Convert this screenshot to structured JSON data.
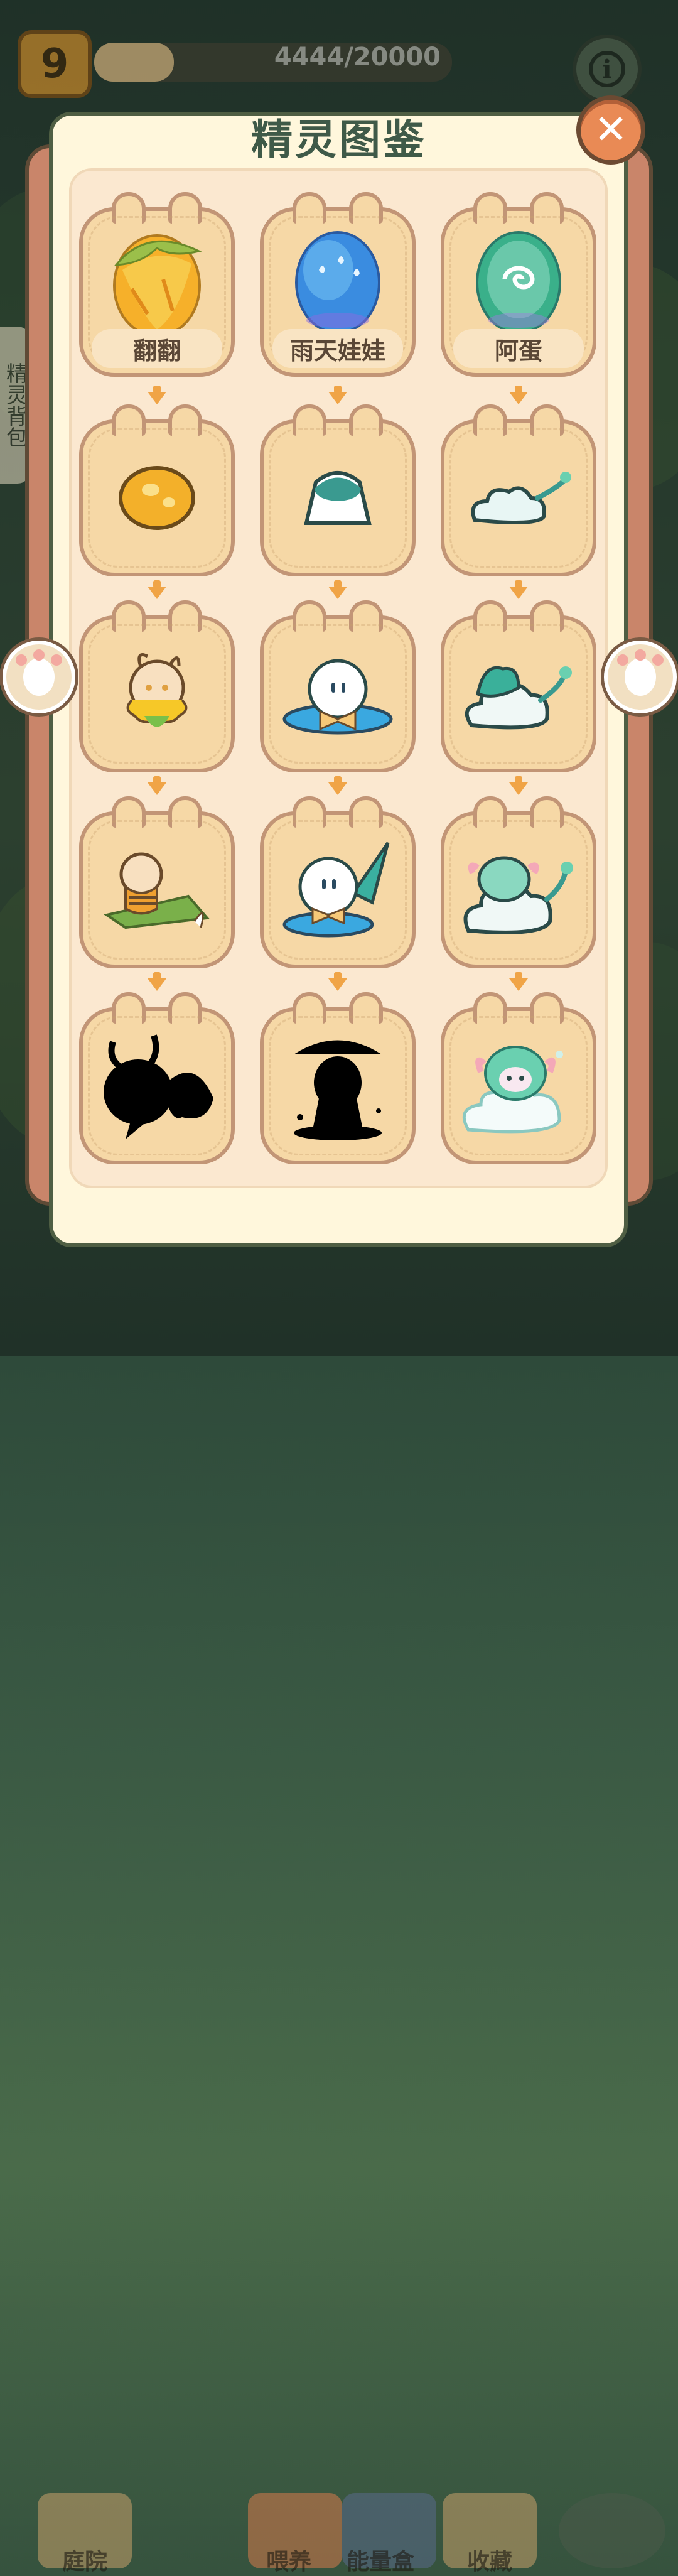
{
  "hud": {
    "level": "9",
    "xp_text": "4444/20000",
    "xp_progress": 0.2222
  },
  "side_tab": {
    "label": "精灵背包"
  },
  "panel": {
    "title": "精灵图鉴"
  },
  "cards": {
    "row1": [
      {
        "name": "翻翻",
        "icon": "yellow-leaf-egg-icon"
      },
      {
        "name": "雨天娃娃",
        "icon": "blue-raindrop-egg-icon"
      },
      {
        "name": "阿蛋",
        "icon": "green-swirl-egg-icon"
      }
    ]
  },
  "bottom_nav": [
    {
      "label": "庭院",
      "icon": "back-arrow-icon"
    },
    {
      "label": "喂养",
      "icon": "food-bowl-icon"
    },
    {
      "label": "能量盒",
      "icon": "energy-box-icon"
    },
    {
      "label": "收藏",
      "icon": "collection-book-icon"
    }
  ],
  "colors": {
    "panel_bg": "#fff7dc",
    "card_bg": "#f6d8a6",
    "card_border": "#c29576",
    "title": "#3f5a48",
    "close": "#e98a55",
    "arrow": "#f0a446"
  }
}
